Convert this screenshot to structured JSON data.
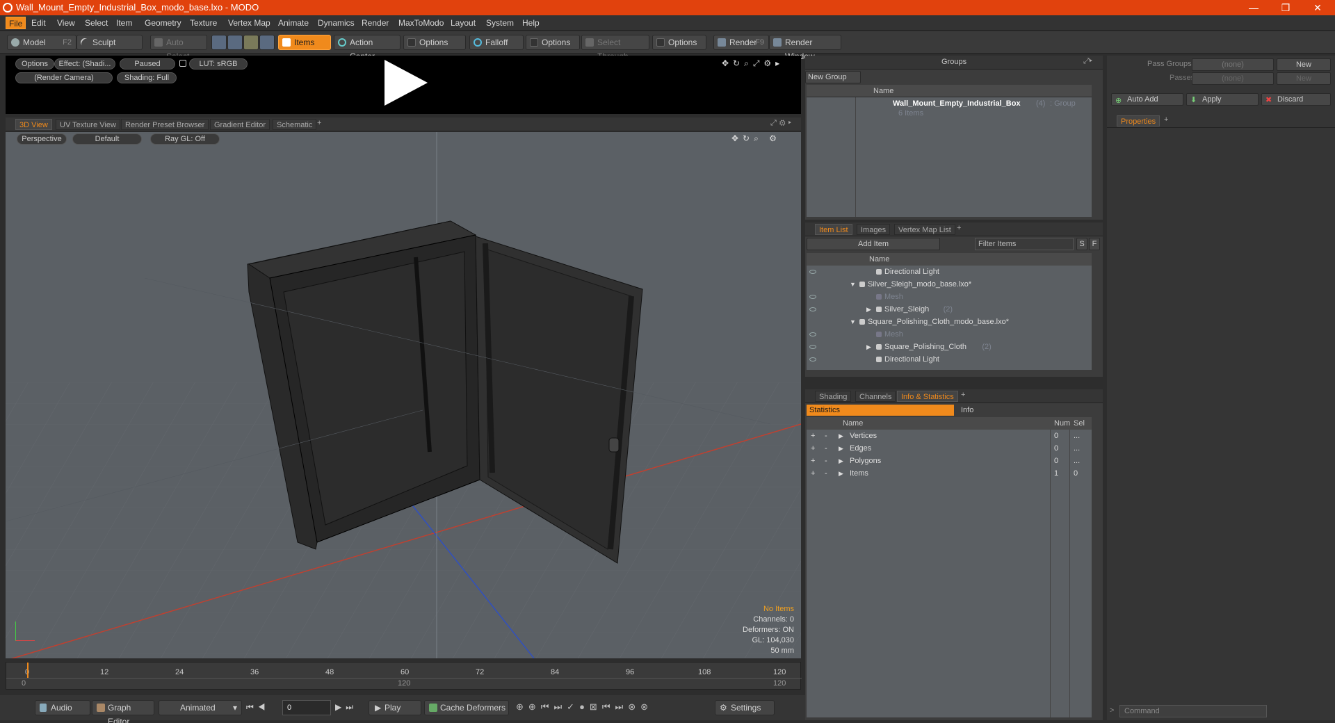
{
  "window": {
    "title": "Wall_Mount_Empty_Industrial_Box_modo_base.lxo - MODO",
    "minimize": "—",
    "restore": "❐",
    "close": "✕"
  },
  "menu": [
    "File",
    "Edit",
    "View",
    "Select",
    "Item",
    "Geometry",
    "Texture",
    "Vertex Map",
    "Animate",
    "Dynamics",
    "Render",
    "MaxToModo",
    "Layout",
    "System",
    "Help"
  ],
  "toolbar": {
    "model": "Model",
    "model_key": "F2",
    "sculpt": "Sculpt",
    "auto_select": "Auto Select",
    "items": "Items",
    "action_center": "Action Center",
    "options1": "Options",
    "falloff": "Falloff",
    "options2": "Options",
    "select_through": "Select Through",
    "options3": "Options",
    "render": "Render",
    "render_key": "F9",
    "render_window": "Render Window"
  },
  "preview": {
    "options": "Options",
    "effect": "Effect: (Shadi...",
    "paused": "Paused",
    "lut": "LUT: sRGB",
    "camera": "(Render Camera)",
    "shading": "Shading: Full"
  },
  "viewtabs": [
    "3D View",
    "UV Texture View",
    "Render Preset Browser",
    "Gradient Editor",
    "Schematic"
  ],
  "viewport": {
    "perspective": "Perspective",
    "default": "Default",
    "raygl": "Ray GL: Off",
    "stats": [
      "No Items",
      "Channels: 0",
      "Deformers: ON",
      "GL: 104,030",
      "50 mm"
    ]
  },
  "ruler": {
    "ticks": [
      "0",
      "12",
      "24",
      "36",
      "48",
      "60",
      "72",
      "84",
      "96",
      "108",
      "120"
    ],
    "sub_left": "0",
    "sub_mid": "120",
    "sub_right": "120"
  },
  "bottom": {
    "audio": "Audio",
    "graph_editor": "Graph Editor",
    "animated": "Animated",
    "frame": "0",
    "play": "Play",
    "cache": "Cache Deformers",
    "settings": "Settings"
  },
  "groups": {
    "title": "Groups",
    "new_group": "New Group",
    "col_name": "Name",
    "item_name": "Wall_Mount_Empty_Industrial_Box",
    "item_count": "(4)",
    "item_type": ": Group",
    "item_sub": "6 Items"
  },
  "itemlist": {
    "tabs": [
      "Item List",
      "Images",
      "Vertex Map List"
    ],
    "add_item": "Add Item",
    "filter": "Filter Items",
    "s": "S",
    "f": "F",
    "col_name": "Name",
    "rows": [
      {
        "label": "Directional Light",
        "indent": 2,
        "dim": false,
        "eye": true,
        "arrow": ""
      },
      {
        "label": "Silver_Sleigh_modo_base.lxo*",
        "indent": 1,
        "dim": false,
        "eye": false,
        "arrow": "▼"
      },
      {
        "label": "Mesh",
        "indent": 2,
        "dim": true,
        "eye": true,
        "arrow": ""
      },
      {
        "label": "Silver_Sleigh",
        "count": "(2)",
        "indent": 2,
        "dim": false,
        "eye": true,
        "arrow": "▶"
      },
      {
        "label": "Square_Polishing_Cloth_modo_base.lxo*",
        "indent": 1,
        "dim": false,
        "eye": false,
        "arrow": "▼"
      },
      {
        "label": "Mesh",
        "indent": 2,
        "dim": true,
        "eye": true,
        "arrow": ""
      },
      {
        "label": "Square_Polishing_Cloth",
        "count": "(2)",
        "indent": 2,
        "dim": false,
        "eye": true,
        "arrow": "▶"
      },
      {
        "label": "Directional Light",
        "indent": 2,
        "dim": false,
        "eye": true,
        "arrow": ""
      }
    ]
  },
  "info": {
    "tabs": [
      "Shading",
      "Channels",
      "Info & Statistics"
    ],
    "statistics": "Statistics",
    "info": "Info",
    "col_name": "Name",
    "col_num": "Num",
    "col_sel": "Sel",
    "rows": [
      {
        "name": "Vertices",
        "num": "0",
        "sel": "..."
      },
      {
        "name": "Edges",
        "num": "0",
        "sel": "..."
      },
      {
        "name": "Polygons",
        "num": "0",
        "sel": "..."
      },
      {
        "name": "Items",
        "num": "1",
        "sel": "0"
      }
    ]
  },
  "right": {
    "pass_groups": "Pass Groups",
    "passes": "Passes",
    "none1": "(none)",
    "none2": "(none)",
    "new1": "New",
    "new2": "New",
    "auto_add": "Auto Add",
    "apply": "Apply",
    "discard": "Discard",
    "properties": "Properties",
    "command": "Command"
  },
  "colors": {
    "accent": "#f08a1c",
    "title": "#e1420d"
  }
}
